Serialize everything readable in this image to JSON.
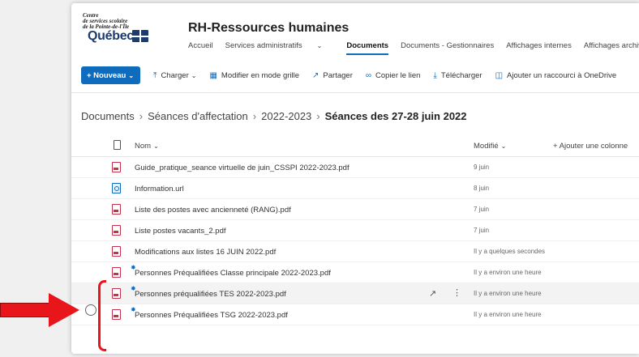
{
  "colors": {
    "accent": "#0f6cbd",
    "pdf": "#c4314b",
    "annotation": "#e8161b"
  },
  "logo": {
    "line1": "Centre",
    "line2": "de services scolaire",
    "line3": "de la Pointe-de-l'Île",
    "quebec": "Québec"
  },
  "site": {
    "title": "RH-Ressources humaines"
  },
  "nav": {
    "items": [
      {
        "label": "Accueil"
      },
      {
        "label": "Services administratifs"
      },
      {
        "label": "Documents"
      },
      {
        "label": "Documents - Gestionnaires"
      },
      {
        "label": "Affichages internes"
      },
      {
        "label": "Affichages archive"
      }
    ]
  },
  "commands": {
    "new": "+ Nouveau",
    "upload": "Charger",
    "grid": "Modifier en mode grille",
    "share": "Partager",
    "copy_link": "Copier le lien",
    "download": "Télécharger",
    "shortcut": "Ajouter un raccourci à OneDrive"
  },
  "breadcrumb": {
    "items": [
      "Documents",
      "Séances d'affectation",
      "2022-2023"
    ],
    "current": "Séances des 27-28 juin 2022"
  },
  "table": {
    "col_name": "Nom",
    "col_modified": "Modifié",
    "col_add": "+ Ajouter une colonne",
    "rows": [
      {
        "name": "Guide_pratique_seance virtuelle de juin_CSSPI 2022-2023.pdf",
        "modified": "9 juin",
        "type": "pdf"
      },
      {
        "name": "Information.url",
        "modified": "8 juin",
        "type": "url"
      },
      {
        "name": "Liste des postes avec ancienneté (RANG).pdf",
        "modified": "7 juin",
        "type": "pdf"
      },
      {
        "name": "Liste postes vacants_2.pdf",
        "modified": "7 juin",
        "type": "pdf"
      },
      {
        "name": "Modifications aux listes 16 JUIN 2022.pdf",
        "modified": "Il y a quelques secondes",
        "type": "pdf"
      },
      {
        "name": "Personnes Préqualifiées Classe principale 2022-2023.pdf",
        "modified": "Il y a environ une heure",
        "type": "pdf"
      },
      {
        "name": "Personnes préqualifiées TES 2022-2023.pdf",
        "modified": "Il y a environ une heure",
        "type": "pdf"
      },
      {
        "name": "Personnes Préqualifiées TSG 2022-2023.pdf",
        "modified": "Il y a environ une heure",
        "type": "pdf"
      }
    ]
  }
}
